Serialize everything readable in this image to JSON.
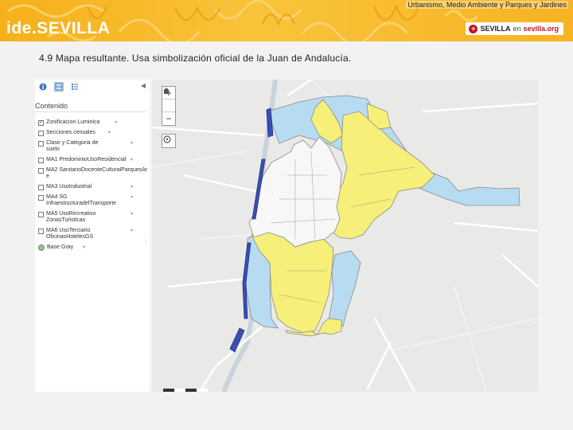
{
  "header": {
    "logo": "ide.SEVILLA",
    "department": "Urbanismo, Medio Ambiente y Parques y Jardines",
    "brand": {
      "word1": "SEVILLA",
      "word2": "en",
      "word3": "sevilla.org"
    },
    "colors": {
      "banner": "#f6b01a",
      "accent": "#c4161c"
    }
  },
  "caption": "4.9 Mapa resultante. Usa simbolización oficial de la Juan de Andalucía.",
  "panel": {
    "tabs": [
      {
        "icon": "info-icon",
        "active": false
      },
      {
        "icon": "layers-icon",
        "active": true
      },
      {
        "icon": "legend-list-icon",
        "active": false
      }
    ],
    "title": "Contenido",
    "layers": [
      {
        "label": "Zonificacion Luminica",
        "checked": true
      },
      {
        "label": "Secciones censales",
        "checked": false
      },
      {
        "label": "Clase y Categoria de suelo",
        "checked": false
      },
      {
        "label": "MA1 PredominioUsoResidencial",
        "checked": false
      },
      {
        "label": "MA2 SanitarioDocenteCulturalParquesAre",
        "checked": false
      },
      {
        "label": "MA3 UsoIndustrial",
        "checked": false
      },
      {
        "label": "MA4 SG InfraestructuradelTransporte",
        "checked": false
      },
      {
        "label": "MA5 UsoRecreativo ZonasTuristicas",
        "checked": false
      },
      {
        "label": "MA6 UsoTerciario OficinasHotelesGS",
        "checked": false
      }
    ],
    "basemap": "Base Gray"
  },
  "map": {
    "zoom_in": "+",
    "zoom_out": "−",
    "colors": {
      "background": "#e9e9e7",
      "road": "#ffffff",
      "river": "#c8d3dc",
      "zone_light_blue": "#b7dcf2",
      "zone_yellow": "#f6f07a",
      "zone_white": "#f7f7f7",
      "zone_dark_blue": "#3a4fb5",
      "outline": "#8a8a8a"
    }
  }
}
